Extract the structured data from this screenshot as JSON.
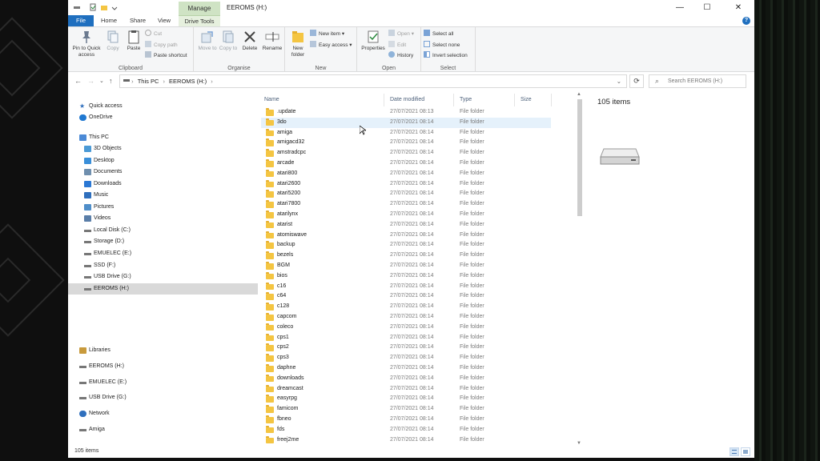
{
  "window": {
    "title": "EEROMS (H:)",
    "context_tab": "Manage",
    "controls": {
      "minimize": "—",
      "maximize": "☐",
      "close": "✕"
    }
  },
  "ribbon_tabs": [
    "File",
    "Home",
    "Share",
    "View",
    "Drive Tools"
  ],
  "help": "?",
  "ribbon": {
    "clipboard": {
      "label": "Clipboard",
      "pin": "Pin to Quick access",
      "copy": "Copy",
      "paste": "Paste",
      "cut": "Cut",
      "copy_path": "Copy path",
      "paste_shortcut": "Paste shortcut"
    },
    "organise": {
      "label": "Organise",
      "move_to": "Move to",
      "copy_to": "Copy to",
      "delete": "Delete",
      "rename": "Rename"
    },
    "new": {
      "label": "New",
      "new_folder": "New folder",
      "new_item": "New item",
      "easy_access": "Easy access"
    },
    "open": {
      "label": "Open",
      "properties": "Properties",
      "open": "Open",
      "edit": "Edit",
      "history": "History"
    },
    "select": {
      "label": "Select",
      "select_all": "Select all",
      "select_none": "Select none",
      "invert_selection": "Invert selection"
    }
  },
  "address": {
    "crumbs": [
      "This PC",
      "EEROMS (H:)"
    ],
    "search_placeholder": "Search EEROMS (H:)"
  },
  "nav": {
    "items": [
      {
        "label": "Quick access",
        "icon": "star-icon"
      },
      {
        "label": "OneDrive",
        "icon": "cloud-icon"
      },
      {
        "label": "This PC",
        "icon": "computer-icon"
      },
      {
        "label": "3D Objects",
        "icon": "cube-icon"
      },
      {
        "label": "Desktop",
        "icon": "desktop-icon"
      },
      {
        "label": "Documents",
        "icon": "document-icon"
      },
      {
        "label": "Downloads",
        "icon": "download-icon"
      },
      {
        "label": "Music",
        "icon": "music-icon"
      },
      {
        "label": "Pictures",
        "icon": "picture-icon"
      },
      {
        "label": "Videos",
        "icon": "video-icon"
      },
      {
        "label": "Local Disk (C:)",
        "icon": "drive-icon"
      },
      {
        "label": "Storage (D:)",
        "icon": "drive-icon"
      },
      {
        "label": "EMUELEC (E:)",
        "icon": "drive-icon"
      },
      {
        "label": "SSD (F:)",
        "icon": "drive-icon"
      },
      {
        "label": "USB Drive (G:)",
        "icon": "drive-icon"
      },
      {
        "label": "EEROMS (H:)",
        "icon": "drive-icon"
      },
      {
        "label": "Libraries",
        "icon": "library-icon"
      },
      {
        "label": "EEROMS (H:)",
        "icon": "drive-icon"
      },
      {
        "label": "EMUELEC (E:)",
        "icon": "drive-icon"
      },
      {
        "label": "USB Drive (G:)",
        "icon": "drive-icon"
      },
      {
        "label": "Network",
        "icon": "network-icon"
      },
      {
        "label": "Amiga",
        "icon": "drive-icon"
      }
    ]
  },
  "columns": {
    "name": "Name",
    "date": "Date modified",
    "type": "Type",
    "size": "Size"
  },
  "files": [
    {
      "name": ".update",
      "date": "27/07/2021 08:13",
      "type": "File folder"
    },
    {
      "name": "3do",
      "date": "27/07/2021 08:14",
      "type": "File folder"
    },
    {
      "name": "amiga",
      "date": "27/07/2021 08:14",
      "type": "File folder"
    },
    {
      "name": "amigacd32",
      "date": "27/07/2021 08:14",
      "type": "File folder"
    },
    {
      "name": "amstradcpc",
      "date": "27/07/2021 08:14",
      "type": "File folder"
    },
    {
      "name": "arcade",
      "date": "27/07/2021 08:14",
      "type": "File folder"
    },
    {
      "name": "atari800",
      "date": "27/07/2021 08:14",
      "type": "File folder"
    },
    {
      "name": "atari2600",
      "date": "27/07/2021 08:14",
      "type": "File folder"
    },
    {
      "name": "atari5200",
      "date": "27/07/2021 08:14",
      "type": "File folder"
    },
    {
      "name": "atari7800",
      "date": "27/07/2021 08:14",
      "type": "File folder"
    },
    {
      "name": "atarilynx",
      "date": "27/07/2021 08:14",
      "type": "File folder"
    },
    {
      "name": "atarist",
      "date": "27/07/2021 08:14",
      "type": "File folder"
    },
    {
      "name": "atomiswave",
      "date": "27/07/2021 08:14",
      "type": "File folder"
    },
    {
      "name": "backup",
      "date": "27/07/2021 08:14",
      "type": "File folder"
    },
    {
      "name": "bezels",
      "date": "27/07/2021 08:14",
      "type": "File folder"
    },
    {
      "name": "BGM",
      "date": "27/07/2021 08:14",
      "type": "File folder"
    },
    {
      "name": "bios",
      "date": "27/07/2021 08:14",
      "type": "File folder"
    },
    {
      "name": "c16",
      "date": "27/07/2021 08:14",
      "type": "File folder"
    },
    {
      "name": "c64",
      "date": "27/07/2021 08:14",
      "type": "File folder"
    },
    {
      "name": "c128",
      "date": "27/07/2021 08:14",
      "type": "File folder"
    },
    {
      "name": "capcom",
      "date": "27/07/2021 08:14",
      "type": "File folder"
    },
    {
      "name": "coleco",
      "date": "27/07/2021 08:14",
      "type": "File folder"
    },
    {
      "name": "cps1",
      "date": "27/07/2021 08:14",
      "type": "File folder"
    },
    {
      "name": "cps2",
      "date": "27/07/2021 08:14",
      "type": "File folder"
    },
    {
      "name": "cps3",
      "date": "27/07/2021 08:14",
      "type": "File folder"
    },
    {
      "name": "daphne",
      "date": "27/07/2021 08:14",
      "type": "File folder"
    },
    {
      "name": "downloads",
      "date": "27/07/2021 08:14",
      "type": "File folder"
    },
    {
      "name": "dreamcast",
      "date": "27/07/2021 08:14",
      "type": "File folder"
    },
    {
      "name": "easyrpg",
      "date": "27/07/2021 08:14",
      "type": "File folder"
    },
    {
      "name": "famicom",
      "date": "27/07/2021 08:14",
      "type": "File folder"
    },
    {
      "name": "fbneo",
      "date": "27/07/2021 08:14",
      "type": "File folder"
    },
    {
      "name": "fds",
      "date": "27/07/2021 08:14",
      "type": "File folder"
    },
    {
      "name": "freej2me",
      "date": "27/07/2021 08:14",
      "type": "File folder"
    }
  ],
  "details": {
    "items_count": "105 items",
    "icon": "drive-icon"
  },
  "status": {
    "items_count": "105 items"
  },
  "colors": {
    "accent": "#1f6fbf",
    "manage_tab": "#cfe3c4",
    "folder": "#f4c542",
    "selected": "#d9d9d9",
    "hover": "#e5f1fb"
  }
}
